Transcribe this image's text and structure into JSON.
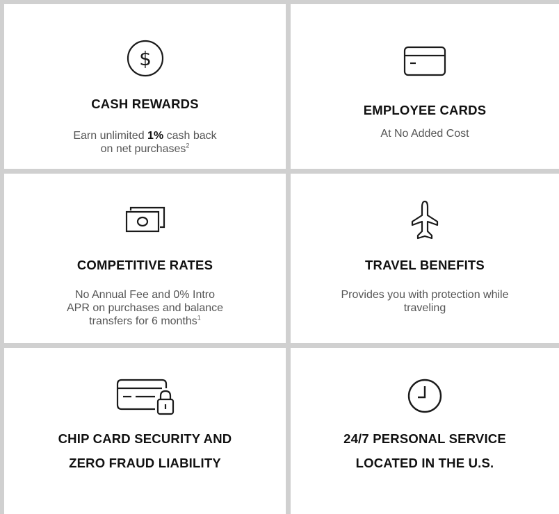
{
  "cards": [
    {
      "icon": "dollar-circle-icon",
      "title": "CASH REWARDS",
      "desc_pre": "Earn unlimited ",
      "desc_bold": "1%",
      "desc_post": " cash back",
      "desc_line2": "on net purchases",
      "desc_sup": "2"
    },
    {
      "icon": "credit-card-icon",
      "title": "EMPLOYEE CARDS",
      "desc": "At No Added Cost"
    },
    {
      "icon": "cash-bill-icon",
      "title": "COMPETITIVE RATES",
      "desc_line1": "No Annual Fee and 0% Intro",
      "desc_line2": "APR on purchases and balance",
      "desc_line3": "transfers for 6 months",
      "desc_sup": "1"
    },
    {
      "icon": "airplane-icon",
      "title": "TRAVEL BENEFITS",
      "desc_line1": "Provides you with protection while",
      "desc_line2": "traveling"
    },
    {
      "icon": "card-lock-icon",
      "title_line1": "CHIP CARD SECURITY AND",
      "title_line2": "ZERO FRAUD LIABILITY"
    },
    {
      "icon": "clock-icon",
      "title_line1": "24/7 PERSONAL SERVICE",
      "title_line2": "LOCATED IN THE U.S."
    }
  ]
}
